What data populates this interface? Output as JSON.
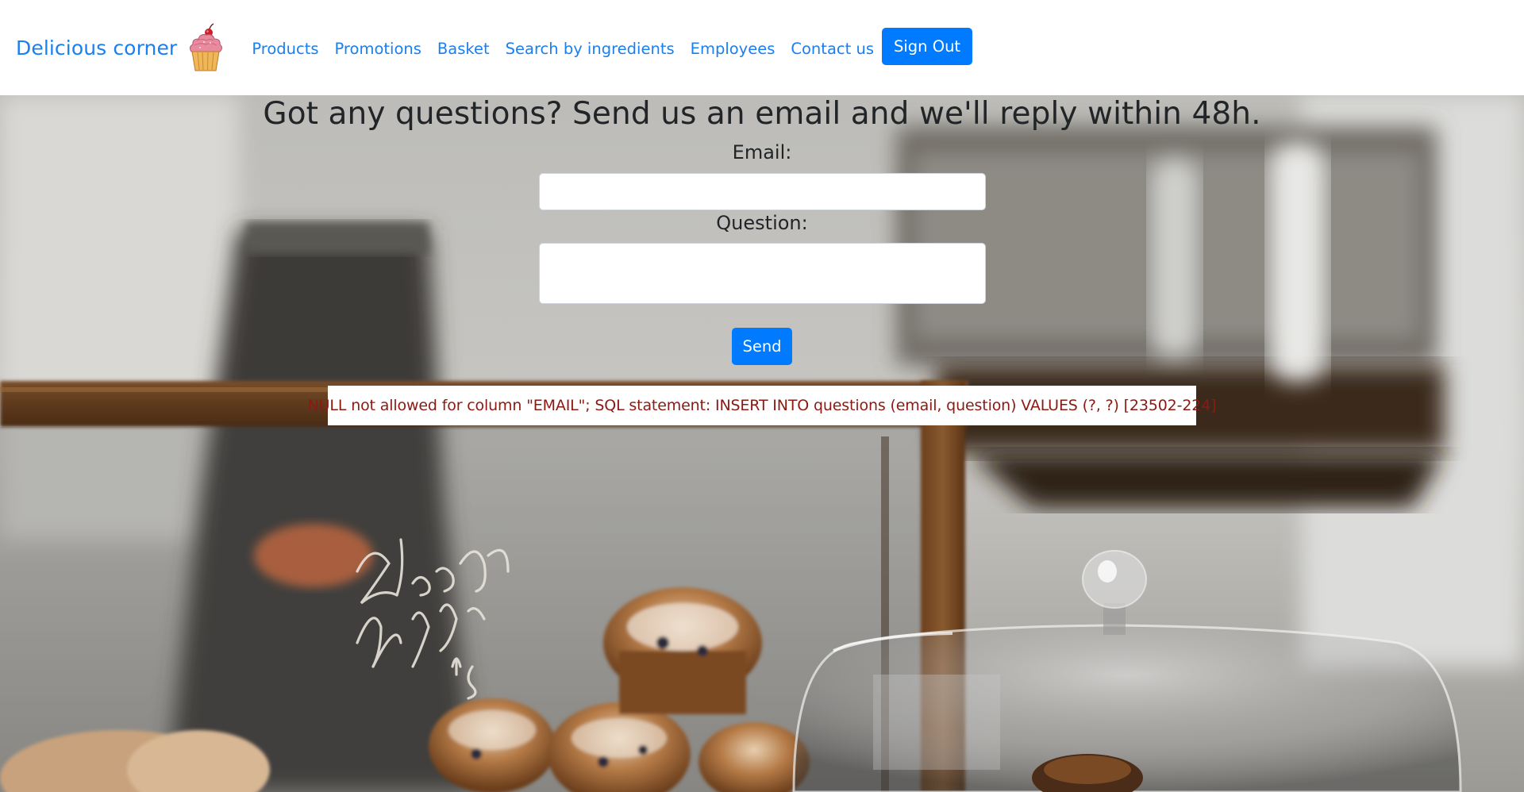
{
  "navbar": {
    "brand": "Delicious corner",
    "links": [
      "Products",
      "Promotions",
      "Basket",
      "Search by ingredients",
      "Employees",
      "Contact us"
    ],
    "sign_out_label": "Sign Out"
  },
  "contact": {
    "heading": "Got any questions? Send us an email and we'll reply within 48h.",
    "email_label": "Email:",
    "email_value": "",
    "question_label": "Question:",
    "question_value": "",
    "send_label": "Send",
    "error_message": "NULL not allowed for column \"EMAIL\"; SQL statement: INSERT INTO questions (email, question) VALUES (?, ?) [23502-224]"
  },
  "background": {
    "subject": "bakery display case with blueberry muffins",
    "chalk_text": [
      "Blueberry",
      "Muffin",
      "$3"
    ]
  },
  "colors": {
    "link": "#1a7ff0",
    "primary_button": "#007bff",
    "error_text": "#8b1a12"
  }
}
